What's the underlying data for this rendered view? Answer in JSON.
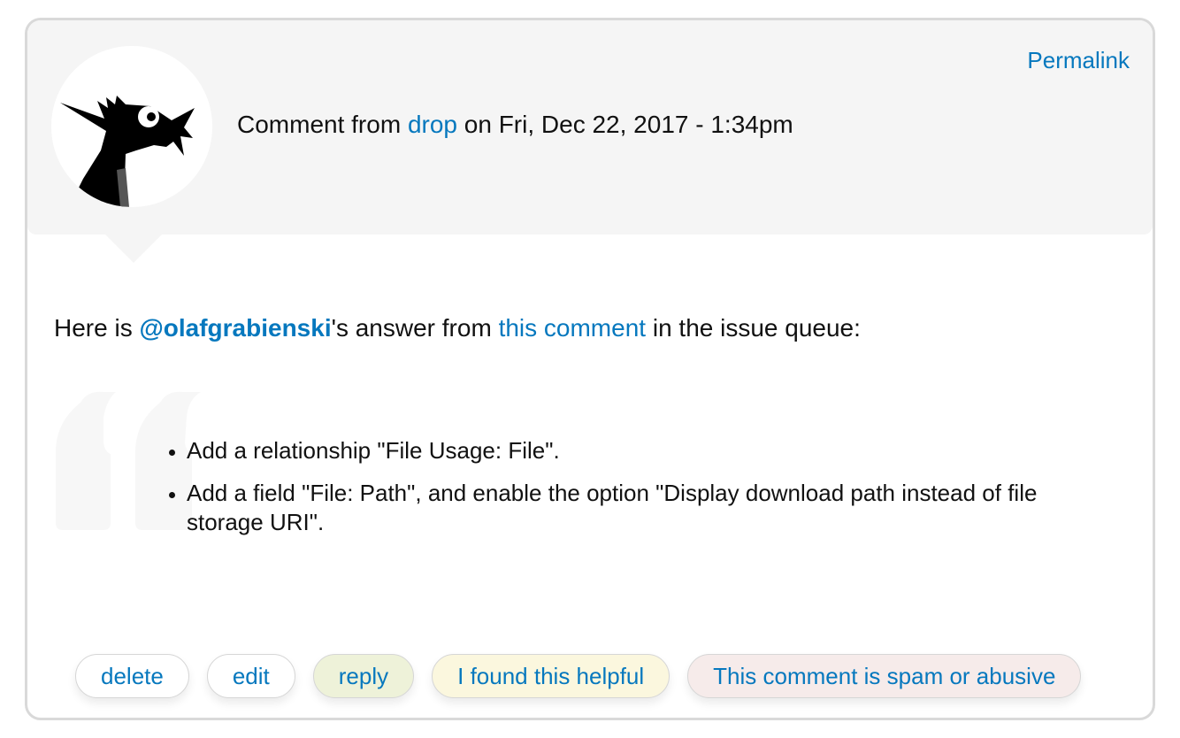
{
  "header": {
    "permalink_label": "Permalink",
    "byline_prefix": "Comment from ",
    "author": "drop",
    "byline_suffix": " on Fri, Dec 22, 2017 - 1:34pm",
    "avatar_icon": "dragon-avatar-icon"
  },
  "body": {
    "intro_prefix": "Here is ",
    "mention": "@olafgrabienski",
    "intro_middle": "'s answer from ",
    "comment_link": "this comment",
    "intro_suffix": " in the issue queue:",
    "quote_icon": "quote-mark-icon",
    "bullets": [
      "Add a relationship \"File Usage: File\".",
      "Add a field \"File: Path\", and enable the option \"Display download path instead of file storage URI\"."
    ]
  },
  "actions": {
    "delete_label": "delete",
    "edit_label": "edit",
    "reply_label": "reply",
    "helpful_label": "I found this helpful",
    "spam_label": "This comment is spam or abusive"
  },
  "colors": {
    "link": "#0678be",
    "header_bg": "#f5f5f5",
    "reply_bg": "#eef2d9",
    "helpful_bg": "#fbf7de",
    "spam_bg": "#f6ebea"
  }
}
